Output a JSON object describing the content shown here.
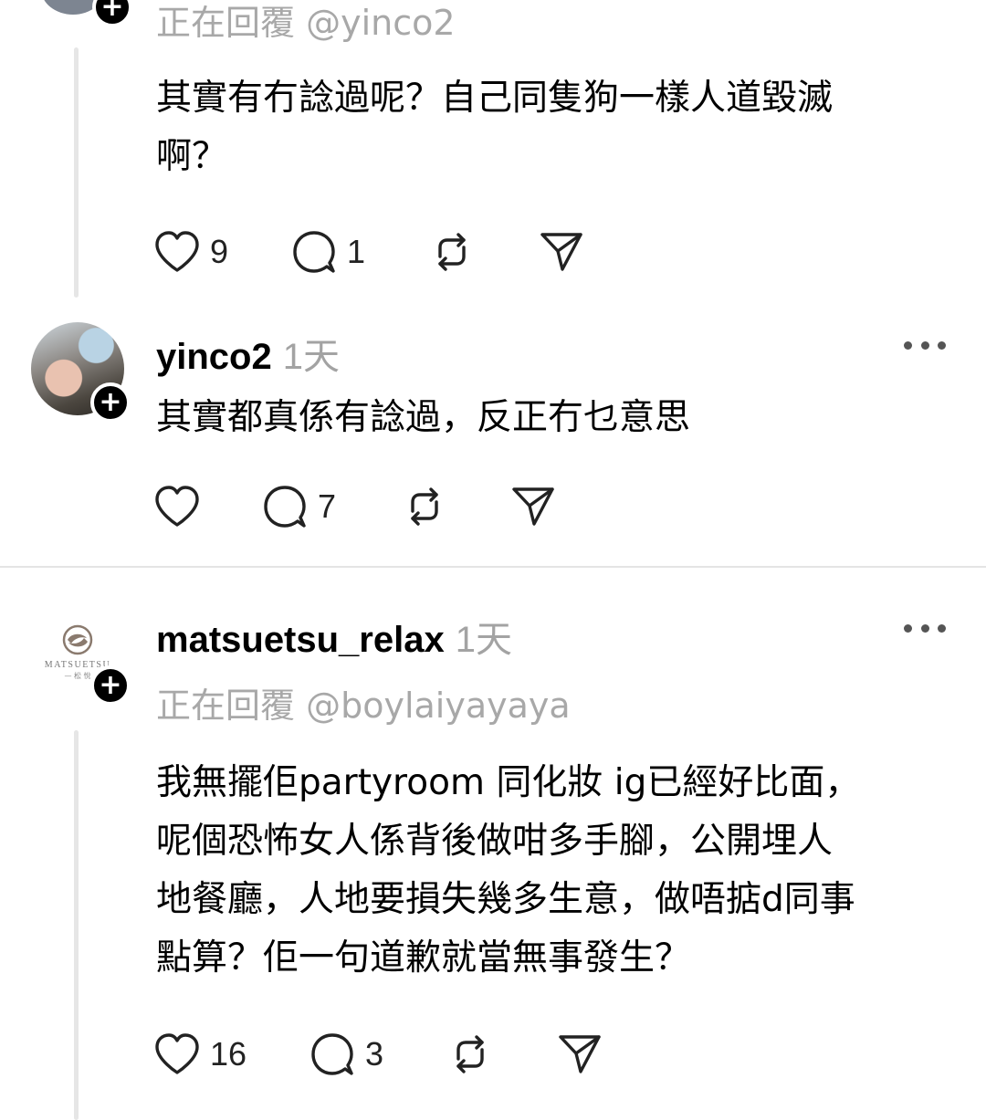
{
  "top_reply": {
    "replying_to": "正在回覆 @yinco2",
    "text": "其實有冇諗過呢？自己同隻狗一樣人道毀滅\n啊？",
    "likes": "9",
    "comments": "1"
  },
  "reply_yinco": {
    "username": "yinco2",
    "time": "1天",
    "text": "其實都真係有諗過，反正冇乜意思",
    "likes": "",
    "comments": "7"
  },
  "reply_matsu": {
    "username": "matsuetsu_relax",
    "time": "1天",
    "replying_to": "正在回覆 @boylaiyayaya",
    "text": "我無擺佢partyroom 同化妝 ig已經好比面，\n呢個恐怖女人係背後做咁多手腳，公開埋人\n地餐廳，人地要損失幾多生意，做唔掂d同事\n點算？佢一句道歉就當無事發生？",
    "likes": "16",
    "comments": "3",
    "avatar_logo_text": "MATSUETSU",
    "avatar_logo_sub": "— 松 悅"
  },
  "icons": {
    "like": "heart-icon",
    "comment": "comment-bubble-icon",
    "repost": "repost-icon",
    "share": "send-icon",
    "more": "more-options-icon",
    "follow": "plus-icon"
  }
}
